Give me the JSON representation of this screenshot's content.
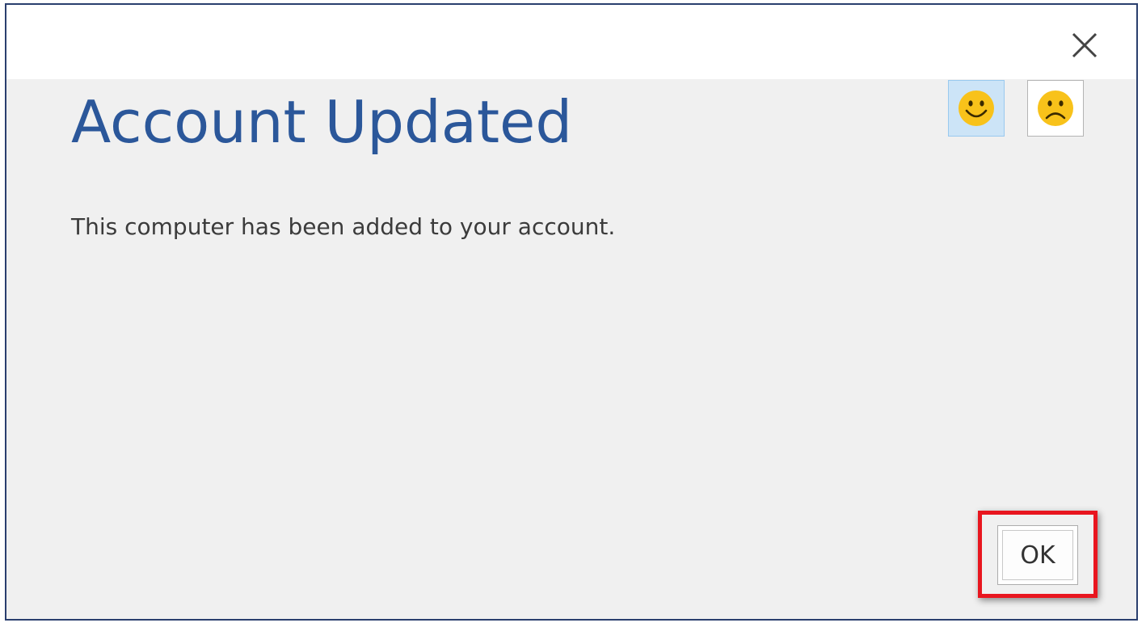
{
  "dialog": {
    "heading": "Account Updated",
    "message": "This computer has been added to your account.",
    "ok_label": "OK",
    "close_icon": "close-icon",
    "feedback": {
      "smile_icon": "smiley-face-icon",
      "frown_icon": "frowny-face-icon"
    }
  },
  "colors": {
    "heading": "#2b579a",
    "background": "#f0f0f0",
    "titlebar": "#ffffff",
    "highlight": "#e8161f",
    "emoji": "#f8c21a"
  }
}
